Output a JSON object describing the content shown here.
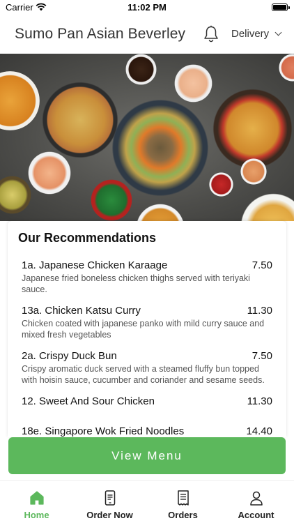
{
  "status_bar": {
    "carrier": "Carrier",
    "time": "11:02 PM"
  },
  "header": {
    "title": "Sumo Pan Asian Beverley",
    "order_type": "Delivery"
  },
  "recommendations": {
    "title": "Our Recommendations",
    "items": [
      {
        "name": "1a. Japanese Chicken Karaage",
        "price": "7.50",
        "description": "Japanese fried boneless chicken thighs served with teriyaki sauce."
      },
      {
        "name": "13a. Chicken Katsu Curry",
        "price": "11.30",
        "description": "Chicken coated with japanese panko with mild curry sauce and mixed fresh vegetables"
      },
      {
        "name": "2a. Crispy Duck Bun",
        "price": "7.50",
        "description": "Crispy aromatic duck served with a steamed fluffy bun topped with hoisin sauce, cucumber and coriander and sesame seeds."
      },
      {
        "name": "12. Sweet And Sour Chicken",
        "price": "11.30",
        "description": ""
      },
      {
        "name": "18e. Singapore Wok Fried Noodles",
        "price": "14.40",
        "description": ""
      }
    ]
  },
  "view_menu_label": "View Menu",
  "tabs": [
    {
      "label": "Home",
      "icon": "home-icon",
      "active": true
    },
    {
      "label": "Order Now",
      "icon": "phone-order-icon",
      "active": false
    },
    {
      "label": "Orders",
      "icon": "receipt-icon",
      "active": false
    },
    {
      "label": "Account",
      "icon": "person-icon",
      "active": false
    }
  ],
  "colors": {
    "accent": "#5cb85c",
    "text": "#222222",
    "muted": "#555555"
  }
}
